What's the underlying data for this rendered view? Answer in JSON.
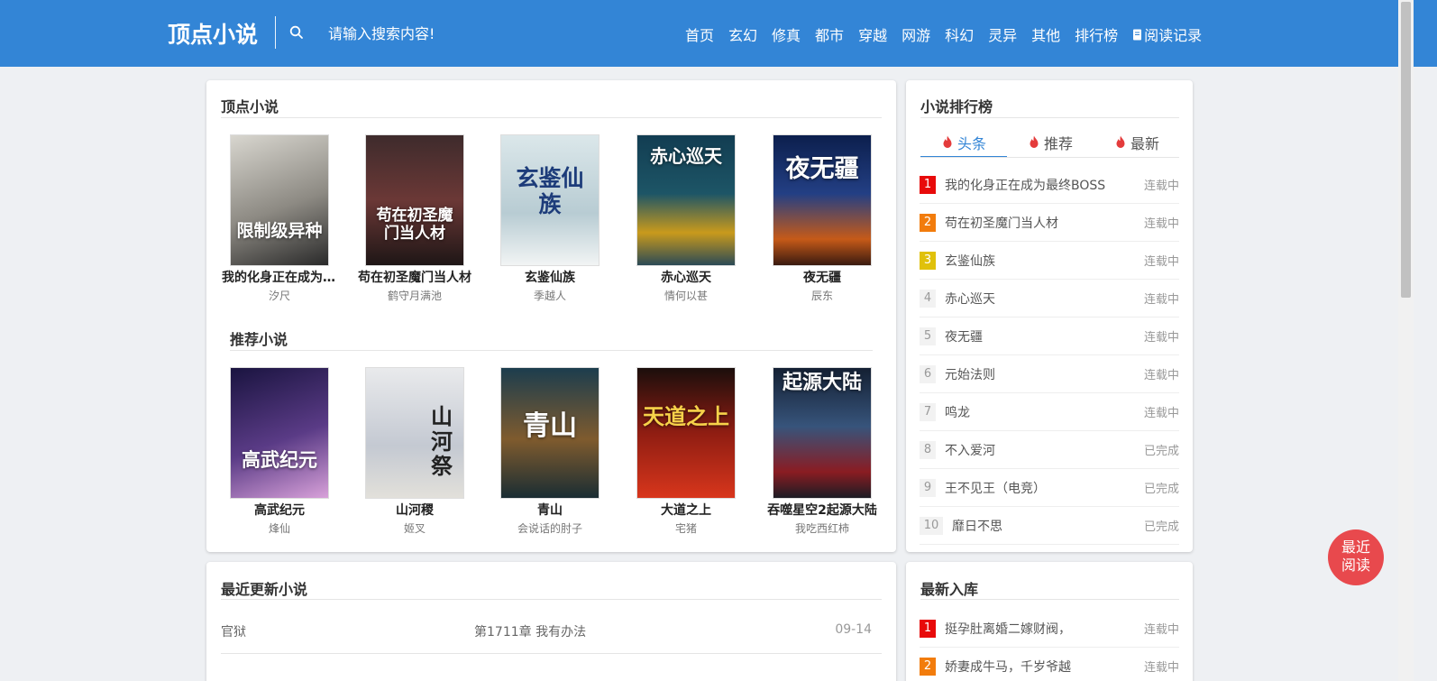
{
  "header": {
    "logo": "顶点小说",
    "search_placeholder": "请输入搜索内容!",
    "nav": [
      {
        "label": "首页"
      },
      {
        "label": "玄幻"
      },
      {
        "label": "修真"
      },
      {
        "label": "都市"
      },
      {
        "label": "穿越"
      },
      {
        "label": "网游"
      },
      {
        "label": "科幻"
      },
      {
        "label": "灵异"
      },
      {
        "label": "其他"
      },
      {
        "label": "排行榜"
      },
      {
        "label": "阅读记录"
      }
    ]
  },
  "featured": {
    "title": "顶点小说",
    "books": [
      {
        "title": "我的化身正在成为最终BOSS",
        "author": "汐尺",
        "cover_text": "限制级异种"
      },
      {
        "title": "苟在初圣魔门当人材",
        "author": "鹤守月满池",
        "cover_text": "苟在初圣魔门当人材"
      },
      {
        "title": "玄鉴仙族",
        "author": "季越人",
        "cover_text": "玄鉴仙族"
      },
      {
        "title": "赤心巡天",
        "author": "情何以甚",
        "cover_text": "赤心巡天"
      },
      {
        "title": "夜无疆",
        "author": "辰东",
        "cover_text": "夜无疆"
      }
    ]
  },
  "recommended": {
    "title": "推荐小说",
    "books": [
      {
        "title": "高武纪元",
        "author": "烽仙",
        "cover_text": "高武纪元"
      },
      {
        "title": "山河稷",
        "author": "姬叉",
        "cover_text": "山河祭"
      },
      {
        "title": "青山",
        "author": "会说话的肘子",
        "cover_text": "青山"
      },
      {
        "title": "大道之上",
        "author": "宅猪",
        "cover_text": "天道之上"
      },
      {
        "title": "吞噬星空2起源大陆",
        "author": "我吃西红柿",
        "cover_text": "起源大陆"
      }
    ]
  },
  "ranking": {
    "title": "小说排行榜",
    "tabs": [
      {
        "label": "头条"
      },
      {
        "label": "推荐"
      },
      {
        "label": "最新"
      }
    ],
    "items": [
      {
        "rank": "1",
        "title": "我的化身正在成为最终BOSS",
        "status": "连载中"
      },
      {
        "rank": "2",
        "title": "苟在初圣魔门当人材",
        "status": "连载中"
      },
      {
        "rank": "3",
        "title": "玄鉴仙族",
        "status": "连载中"
      },
      {
        "rank": "4",
        "title": "赤心巡天",
        "status": "连载中"
      },
      {
        "rank": "5",
        "title": "夜无疆",
        "status": "连载中"
      },
      {
        "rank": "6",
        "title": "元始法则",
        "status": "连载中"
      },
      {
        "rank": "7",
        "title": "鸣龙",
        "status": "连载中"
      },
      {
        "rank": "8",
        "title": "不入爱河",
        "status": "已完成"
      },
      {
        "rank": "9",
        "title": "王不见王（电竞）",
        "status": "已完成"
      },
      {
        "rank": "10",
        "title": "靡日不思",
        "status": "已完成"
      }
    ]
  },
  "updates": {
    "title": "最近更新小说",
    "items": [
      {
        "name": "官狱",
        "chapter": "第1711章 我有办法",
        "date": "09-14"
      }
    ]
  },
  "newest": {
    "title": "最新入库",
    "items": [
      {
        "rank": "1",
        "title": "挺孕肚离婚二嫁财阀，",
        "status": "连载中"
      },
      {
        "rank": "2",
        "title": "娇妻成牛马，千岁爷越",
        "status": "连载中"
      }
    ]
  },
  "float_button": {
    "line1": "最近",
    "line2": "阅读"
  },
  "colors": {
    "header_bg": "#3385d6",
    "accent": "#3385d6",
    "float_bg": "#e8494d",
    "rank1": "#e80a0a",
    "rank2": "#f27c0c",
    "rank3": "#e0c10b"
  }
}
